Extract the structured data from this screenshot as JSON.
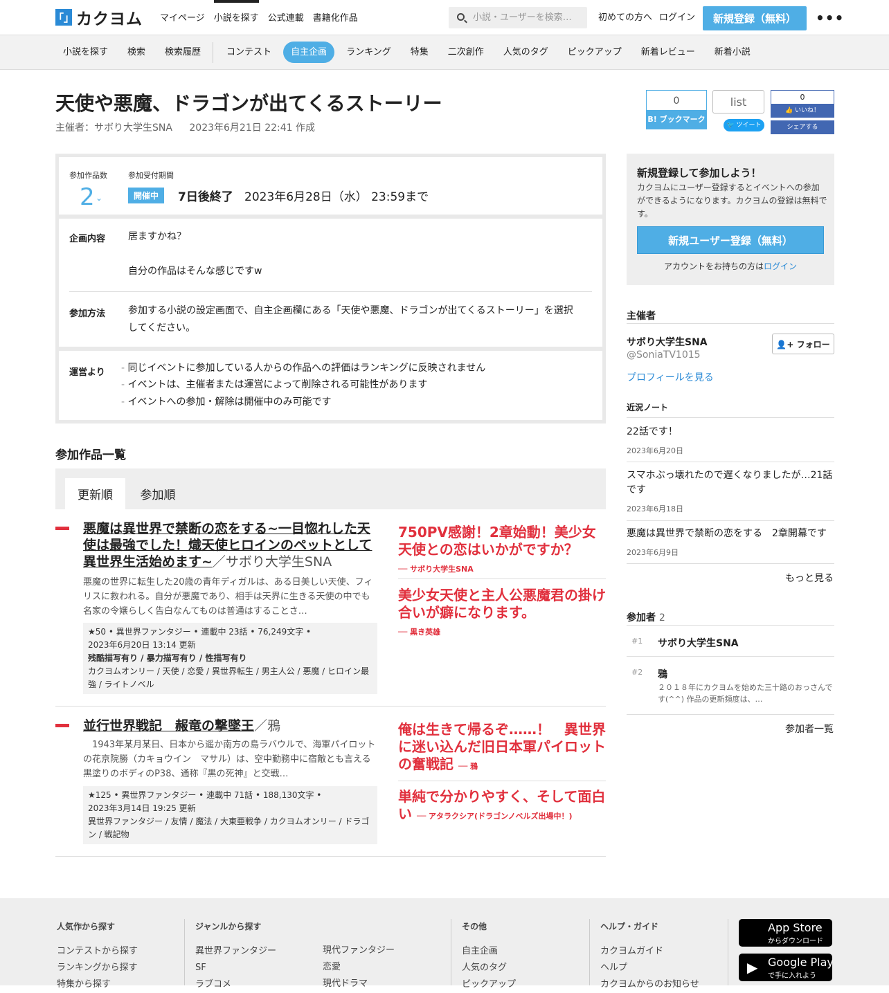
{
  "header": {
    "logo_mark": "「」",
    "logo_text": "カクヨム",
    "nav": [
      "マイページ",
      "小説を探す",
      "公式連載",
      "書籍化作品"
    ],
    "search_placeholder": "小説・ユーザーを検索…",
    "first_time": "初めての方へ",
    "login": "ログイン",
    "register": "新規登録（無料）",
    "more": "•••"
  },
  "subnav": {
    "items": [
      "小説を探す",
      "検索",
      "検索履歴"
    ],
    "items2": [
      "コンテスト",
      "自主企画",
      "ランキング",
      "特集",
      "二次創作",
      "人気のタグ",
      "ピックアップ",
      "新着レビュー",
      "新着小説"
    ]
  },
  "page": {
    "title": "天使や悪魔、ドラゴンが出てくるストーリー",
    "host": "主催者：サボり大学生SNA",
    "created": "2023年6月21日 22:41 作成"
  },
  "share": {
    "hatena_count": "0",
    "hatena_label": "B! ブックマーク",
    "twitter_box": "list",
    "twitter_btn": "ツイート",
    "fb_count": "0",
    "fb_like": "いいね！",
    "fb_share": "シェアする"
  },
  "event": {
    "count_label": "参加作品数",
    "count": "2",
    "period_label": "参加受付期間",
    "status": "開催中",
    "remaining": "7日後終了",
    "deadline": "2023年6月28日（水） 23:59まで",
    "content_label": "企画内容",
    "content_line1": "居ますかね？",
    "content_line2": "自分の作品はそんな感じですw",
    "method_label": "参加方法",
    "method": "参加する小説の設定画面で、自主企画欄にある「天使や悪魔、ドラゴンが出てくるストーリー」を選択してください。",
    "notice_label": "運営より",
    "notices": [
      "同じイベントに参加している人からの作品への評価はランキングに反映されません",
      "イベントは、主催者または運営によって削除される可能性があります",
      "イベントへの参加・解除は開催中のみ可能です"
    ]
  },
  "works": {
    "heading": "参加作品一覧",
    "tabs": [
      "更新順",
      "参加順"
    ],
    "list": [
      {
        "title": "悪魔は異世界で禁断の恋をする~一目惚れした天使は最強でした！熾天使ヒロインのペットとして異世界生活始めます~",
        "author": "／サボり大学生SNA",
        "desc": "悪魔の世界に転生した20歳の青年ディガルは、ある日美しい天使、フィリスに救われる。自分が悪魔であり、相手は天界に生きる天使の中でも名家の令嬢らしく告白なんてものは普通はすることさ…",
        "stats": "★50 • 異世界ファンタジー • 連載中 23話 • 76,249文字 •",
        "updated": "2023年6月20日 13:14 更新",
        "warnings": "残酷描写有り / 暴力描写有り / 性描写有り",
        "tags": "カクヨムオンリー / 天使 / 恋愛 / 異世界転生 / 男主人公 / 悪魔 / ヒロイン最強 / ライトノベル",
        "rev1": "750PV感謝！2章始動！美少女天使との恋はいかがですか？",
        "rev1_by": "── サボり大学生SNA",
        "rev2": "美少女天使と主人公悪魔君の掛け合いが癖になります。",
        "rev2_by": "── 黒き英雄"
      },
      {
        "title": "並行世界戦記　赧竜の撃墜王",
        "author": "／鴉",
        "desc": "　1943年某月某日、日本から遥か南方の島ラバウルで、海軍パイロットの花京院勝（カキョウイン　マサル）は、空中勤務中に宿敵とも言える黒塗りのボディのP38、通称『黒の死神』と交戦…",
        "stats": "★125 • 異世界ファンタジー • 連載中 71話 • 188,130文字 •",
        "updated": "2023年3月14日 19:25 更新",
        "tags": "異世界ファンタジー / 友情 / 魔法 / 大東亜戦争 / カクヨムオンリー / ドラゴン / 戦記物",
        "rev1": "俺は生きて帰るぞ……！　異世界に迷い込んだ旧日本軍パイロットの奮戦記",
        "rev1_by": "── 鴉",
        "rev2": "単純で分かりやすく、そして面白い",
        "rev2_by": "── アタラクシア(ドラゴンノベルズ出場中！)"
      }
    ]
  },
  "signup": {
    "heading": "新規登録して参加しよう！",
    "text": "カクヨムにユーザー登録するとイベントへの参加ができるようになります。カクヨムの登録は無料です。",
    "button": "新規ユーザー登録（無料）",
    "account": "アカウントをお持ちの方は",
    "login": "ログイン"
  },
  "host": {
    "heading": "主催者",
    "name": "サボり大学生SNA",
    "id": "@SoniaTV1015",
    "follow": "フォロー",
    "profile": "プロフィールを見る"
  },
  "notes": {
    "heading": "近況ノート",
    "items": [
      {
        "t": "22話です！",
        "d": "2023年6月20日"
      },
      {
        "t": "スマホぶっ壊れたので遅くなりましたが…21話です",
        "d": "2023年6月18日"
      },
      {
        "t": "悪魔は異世界で禁断の恋をする　2章開幕です",
        "d": "2023年6月9日"
      }
    ],
    "more": "もっと見る"
  },
  "participants": {
    "heading": "参加者",
    "count": "2",
    "list": [
      {
        "rank": "#1",
        "name": "サボり大学生SNA",
        "bio": ""
      },
      {
        "rank": "#2",
        "name": "鴉",
        "bio": "２０１８年にカクヨムを始めた三十路のおっさんです(^^) 作品の更新頻度は、…"
      }
    ],
    "all": "参加者一覧"
  },
  "footer": {
    "c1_h": "人気作から探す",
    "c1": [
      "コンテストから探す",
      "ランキングから探す",
      "特集から探す"
    ],
    "c2_h": "ジャンルから探す",
    "c2a": [
      "異世界ファンタジー",
      "SF",
      "ラブコメ"
    ],
    "c2b": [
      "現代ファンタジー",
      "恋愛",
      "現代ドラマ"
    ],
    "c3_h": "その他",
    "c3": [
      "自主企画",
      "人気のタグ",
      "ピックアップ"
    ],
    "c4_h": "ヘルプ・ガイド",
    "c4": [
      "カクヨムガイド",
      "ヘルプ",
      "カクヨムからのお知らせ"
    ],
    "appstore1": "App Store",
    "appstore2": "からダウンロード",
    "gplay1": "Google Play",
    "gplay2": "で手に入れよう"
  }
}
